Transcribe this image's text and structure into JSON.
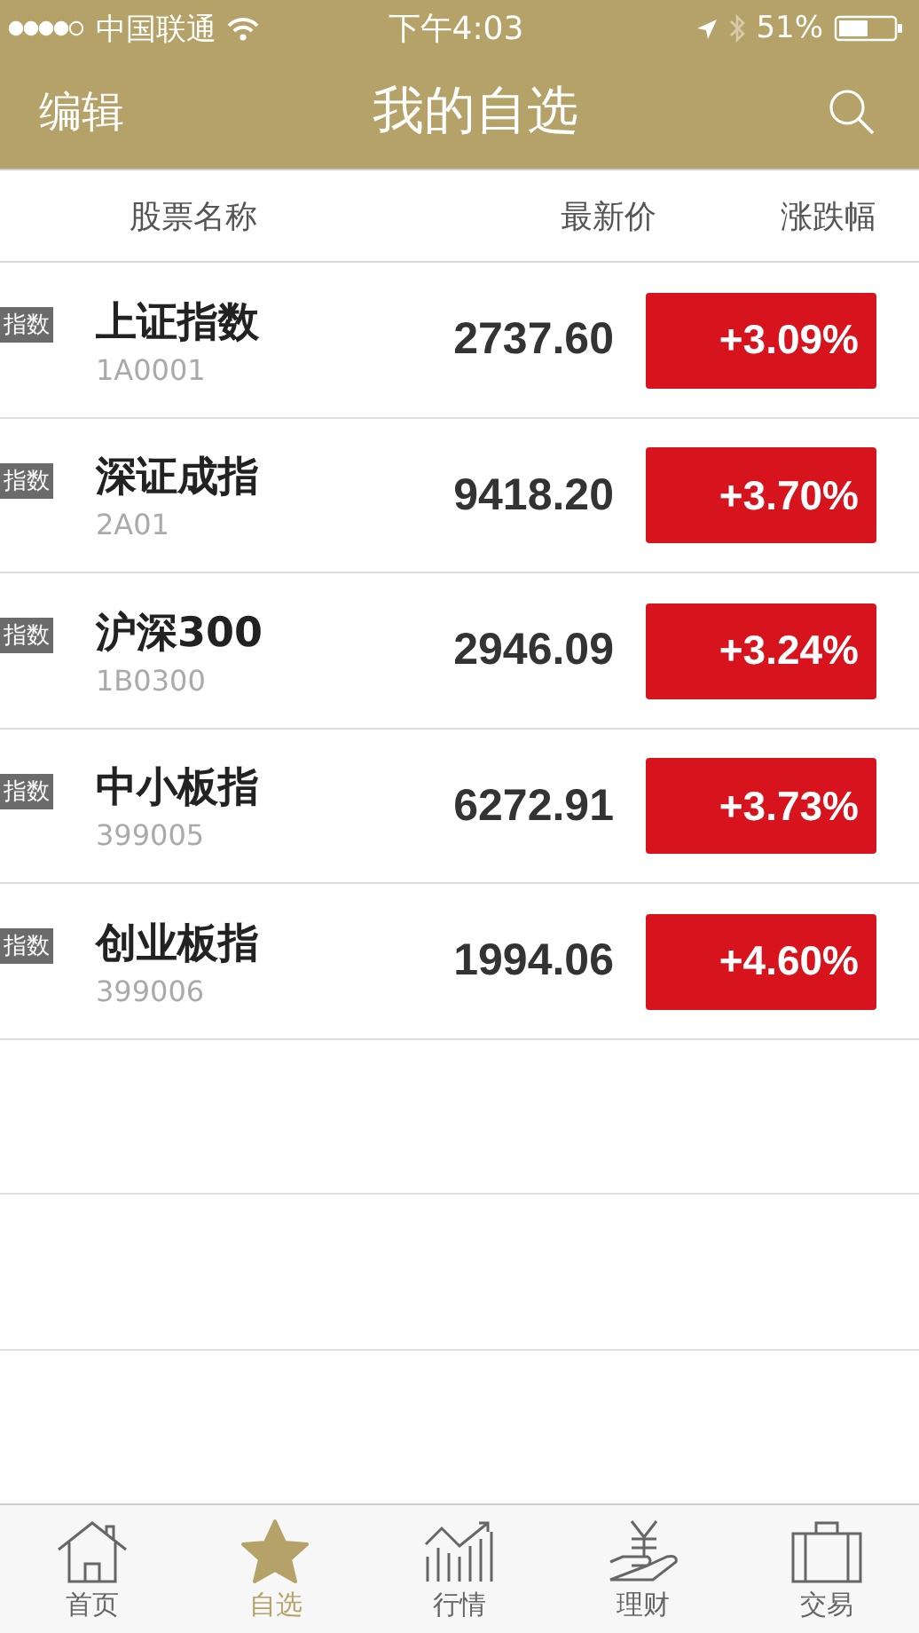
{
  "status_bar": {
    "carrier": "中国联通",
    "time": "下午4:03",
    "battery": "51%"
  },
  "nav": {
    "left": "编辑",
    "title": "我的自选"
  },
  "table": {
    "columns": [
      "股票名称",
      "最新价",
      "涨跌幅"
    ],
    "rows": [
      {
        "badge": "指数",
        "name": "上证指数",
        "code": "1A0001",
        "price": "2737.60",
        "change": "+3.09%"
      },
      {
        "badge": "指数",
        "name": "深证成指",
        "code": "2A01",
        "price": "9418.20",
        "change": "+3.70%"
      },
      {
        "badge": "指数",
        "name": "沪深300",
        "code": "1B0300",
        "price": "2946.09",
        "change": "+3.24%"
      },
      {
        "badge": "指数",
        "name": "中小板指",
        "code": "399005",
        "price": "6272.91",
        "change": "+3.73%"
      },
      {
        "badge": "指数",
        "name": "创业板指",
        "code": "399006",
        "price": "1994.06",
        "change": "+4.60%"
      }
    ]
  },
  "tab_bar": [
    {
      "label": "首页",
      "selected": false
    },
    {
      "label": "自选",
      "selected": true
    },
    {
      "label": "行情",
      "selected": false
    },
    {
      "label": "理财",
      "selected": false
    },
    {
      "label": "交易",
      "selected": false
    }
  ]
}
